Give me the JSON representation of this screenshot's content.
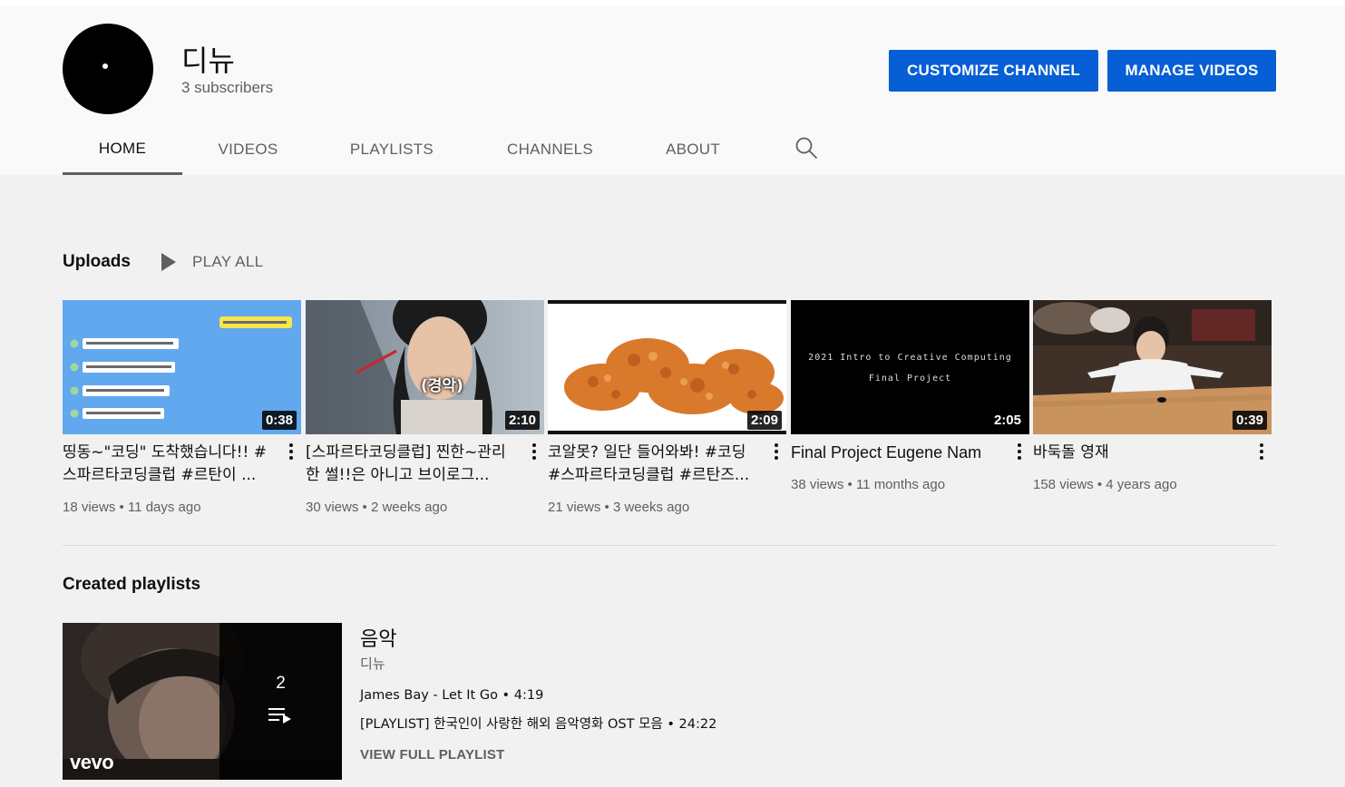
{
  "channel": {
    "name": "디뉴",
    "subscribers": "3 subscribers"
  },
  "buttons": {
    "customize": "CUSTOMIZE CHANNEL",
    "manage": "MANAGE VIDEOS"
  },
  "tabs": [
    "HOME",
    "VIDEOS",
    "PLAYLISTS",
    "CHANNELS",
    "ABOUT"
  ],
  "active_tab": "HOME",
  "uploads": {
    "title": "Uploads",
    "play_all": "PLAY ALL",
    "videos": [
      {
        "title": "띵동~\"코딩\" 도착했습니다!! # 스파르타코딩클럽 #르탄이 ...",
        "duration": "0:38",
        "views": "18 views",
        "age": "11 days ago"
      },
      {
        "title": "[스파르타코딩클럽] 찐한~관리한 썰!!은 아니고 브이로그...",
        "duration": "2:10",
        "views": "30 views",
        "age": "2 weeks ago",
        "caption": "(경악)"
      },
      {
        "title": "코알못? 일단 들어와봐! #코딩 #스파르타코딩클럽 #르탄즈...",
        "duration": "2:09",
        "views": "21 views",
        "age": "3 weeks ago"
      },
      {
        "title": "Final Project Eugene Nam",
        "duration": "2:05",
        "views": "38 views",
        "age": "11 months ago",
        "thumb_line1": "2021 Intro to Creative Computing",
        "thumb_line2": "Final Project"
      },
      {
        "title": "바둑돌 영재",
        "duration": "0:39",
        "views": "158 views",
        "age": "4 years ago"
      }
    ]
  },
  "playlists": {
    "title": "Created playlists",
    "item": {
      "name": "음악",
      "owner": "디뉴",
      "count": "2",
      "brand": "vevo",
      "tracks": [
        {
          "title": "James Bay - Let It Go",
          "length": "4:19"
        },
        {
          "title": "[PLAYLIST] 한국인이 사랑한 해외 음악영화 OST 모음",
          "length": "24:22"
        }
      ],
      "view_full": "VIEW FULL PLAYLIST"
    }
  }
}
